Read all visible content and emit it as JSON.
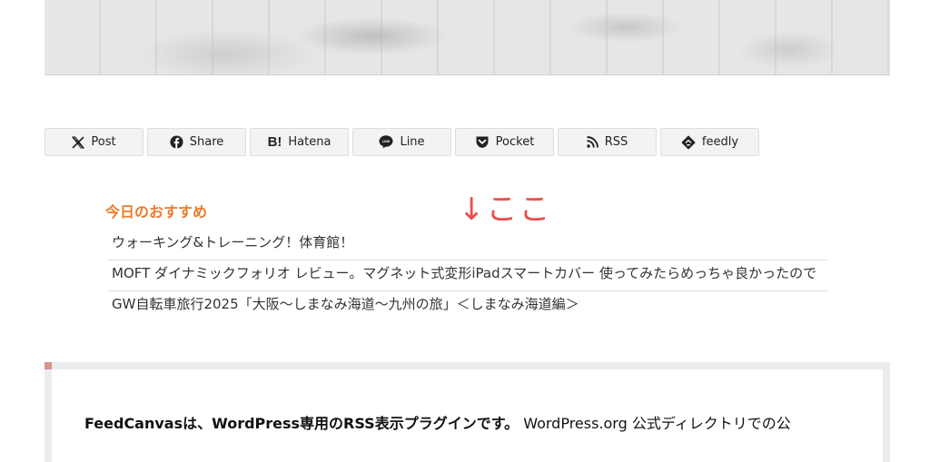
{
  "share": {
    "buttons": [
      {
        "label": "Post",
        "icon": "x-icon"
      },
      {
        "label": "Share",
        "icon": "facebook-icon"
      },
      {
        "label": "Hatena",
        "icon": "hatena-icon"
      },
      {
        "label": "Line",
        "icon": "line-icon"
      },
      {
        "label": "Pocket",
        "icon": "pocket-icon"
      },
      {
        "label": "RSS",
        "icon": "rss-icon"
      },
      {
        "label": "feedly",
        "icon": "feedly-icon"
      }
    ]
  },
  "recommend": {
    "title": "今日のおすすめ",
    "annotation": "↓ここ",
    "items": [
      "ウォーキング&トレーニング！体育館！",
      "MOFT ダイナミックフォリオ レビュー。マグネット式変形iPadスマートカバー 使ってみたらめっちゃ良かったので",
      "GW自転車旅行2025「大阪〜しまなみ海道〜九州の旅」＜しまなみ海道編＞"
    ]
  },
  "card": {
    "bold_text": "FeedCanvasは、WordPress専用のRSS表示プラグインです。",
    "normal_text": " WordPress.org 公式ディレクトリでの公"
  },
  "colors": {
    "accent_orange": "#ee7a2a",
    "annotation_red": "#e8504a",
    "card_accent": "#d4958a"
  }
}
